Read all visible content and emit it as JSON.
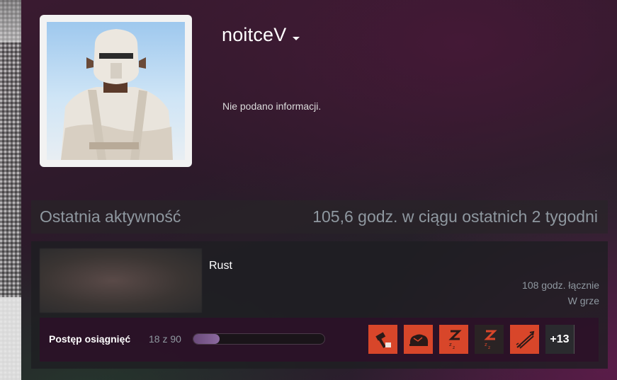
{
  "profile": {
    "persona_name": "noitceV",
    "summary": "Nie podano informacji."
  },
  "recent_activity": {
    "title": "Ostatnia aktywność",
    "playtime_two_weeks": "105,6 godz. w ciągu ostatnich 2 tygodni"
  },
  "game": {
    "name": "Rust",
    "hours_total": "108 godz. łącznie",
    "status": "W grze",
    "achievements": {
      "label": "Postęp osiągnięć",
      "count_text": "18 z 90",
      "progress_fraction": 0.2,
      "more_label": "+13",
      "icons": [
        {
          "name": "hammer-achievement-icon",
          "style": "orange"
        },
        {
          "name": "boulder-achievement-icon",
          "style": "orange"
        },
        {
          "name": "sleep-achievement-icon",
          "style": "orange"
        },
        {
          "name": "sleep-dark-achievement-icon",
          "style": "dark"
        },
        {
          "name": "arrows-achievement-icon",
          "style": "orange"
        }
      ]
    }
  },
  "colors": {
    "achievement_orange": "#d8462a",
    "muted_text": "#8f98a0"
  }
}
